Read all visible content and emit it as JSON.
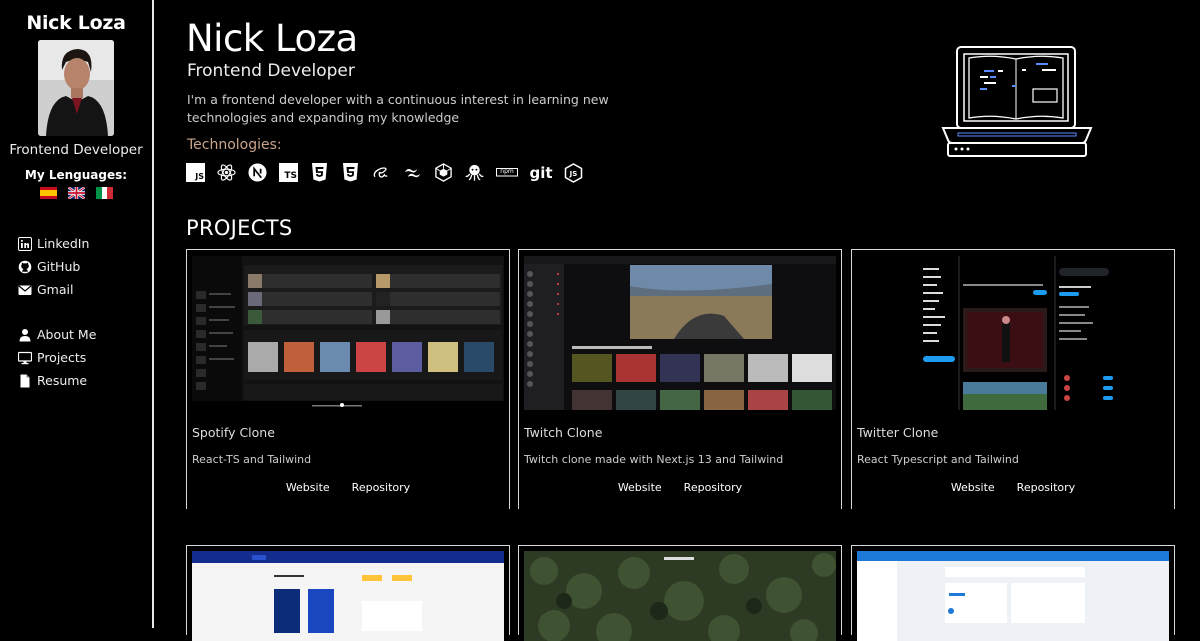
{
  "sidebar": {
    "name": "Nick Loza",
    "title": "Frontend Developer",
    "languages_label": "My Lenguages:",
    "languages": [
      "Spanish",
      "English",
      "Italian"
    ],
    "links": [
      {
        "label": "LinkedIn",
        "icon": "linkedin-icon"
      },
      {
        "label": "GitHub",
        "icon": "github-icon"
      },
      {
        "label": "Gmail",
        "icon": "mail-icon"
      },
      {
        "label": "About Me",
        "icon": "user-icon"
      },
      {
        "label": "Projects",
        "icon": "monitor-icon"
      },
      {
        "label": "Resume",
        "icon": "document-icon"
      }
    ]
  },
  "header": {
    "name": "Nick Loza",
    "role": "Frontend Developer",
    "description": "I'm a frontend developer with a continuous interest in learning new technologies and expanding my knowledge",
    "technologies_label": "Technologies:",
    "technologies": [
      "js-icon",
      "react-icon",
      "nextjs-icon",
      "ts-icon",
      "html5-icon",
      "css3-icon",
      "sass-icon",
      "tailwind-icon",
      "webpack-icon",
      "octopus-icon",
      "npm-icon",
      "git-icon",
      "nodejs-icon"
    ],
    "tech_texts": {
      "js": "JS",
      "ts": "TS",
      "git": "git",
      "npm": "npm"
    }
  },
  "projects": {
    "title": "PROJECTS",
    "cards": [
      {
        "title": "Spotify Clone",
        "description": "React-TS and Tailwind",
        "website": "Website",
        "repository": "Repository"
      },
      {
        "title": "Twitch Clone",
        "description": "Twitch clone made with Next.js 13 and Tailwind",
        "website": "Website",
        "repository": "Repository"
      },
      {
        "title": "Twitter Clone",
        "description": "React Typescript and Tailwind",
        "website": "Website",
        "repository": "Repository"
      }
    ]
  },
  "colors": {
    "background": "#000000",
    "accent_label": "#c8a48a",
    "border": "#d8d8d8"
  }
}
